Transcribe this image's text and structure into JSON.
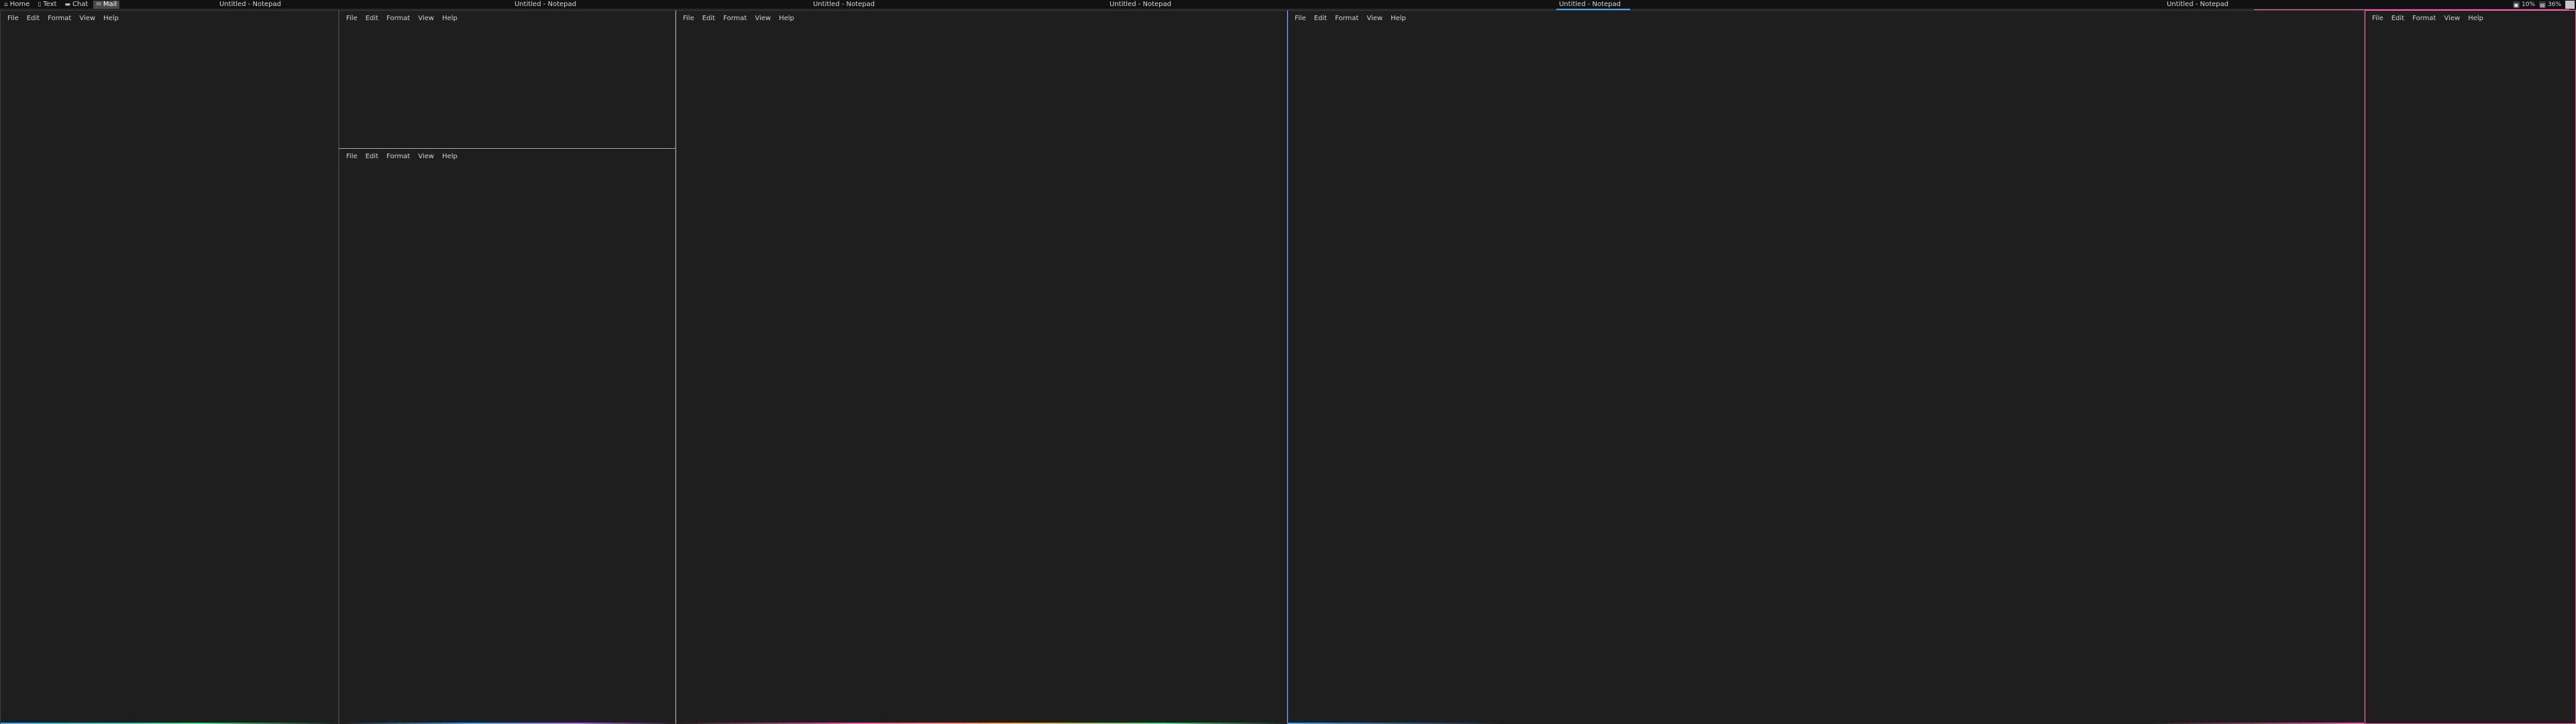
{
  "workspaces": [
    {
      "label": "Home",
      "icon": "home-icon",
      "glyph": "⌂",
      "active": false
    },
    {
      "label": "Text",
      "icon": "document-icon",
      "glyph": "▯",
      "active": false
    },
    {
      "label": "Chat",
      "icon": "chat-icon",
      "glyph": "▬",
      "active": false
    },
    {
      "label": "Mail",
      "icon": "mail-icon",
      "glyph": "✉",
      "active": true
    }
  ],
  "titles": [
    "Untitled - Notepad",
    "Untitled - Notepad",
    "Untitled - Notepad",
    "Untitled - Notepad",
    "Untitled - Notepad",
    "Untitled - Notepad"
  ],
  "tray": {
    "cpu": {
      "icon": "cpu-icon",
      "label": "10%"
    },
    "memory": {
      "icon": "memory-icon",
      "label": "36%"
    }
  },
  "menu": [
    "File",
    "Edit",
    "Format",
    "View",
    "Help"
  ],
  "colors": {
    "background": "#1b1b1b",
    "window": "#1e1e1e",
    "border": "#3d3d3d",
    "accent_blue": "#3da5ff",
    "accent_pink": "#ff5fa8",
    "accent_orange": "#ff9f3d",
    "accent_green": "#3ddc84",
    "accent_purple": "#b06bff"
  }
}
